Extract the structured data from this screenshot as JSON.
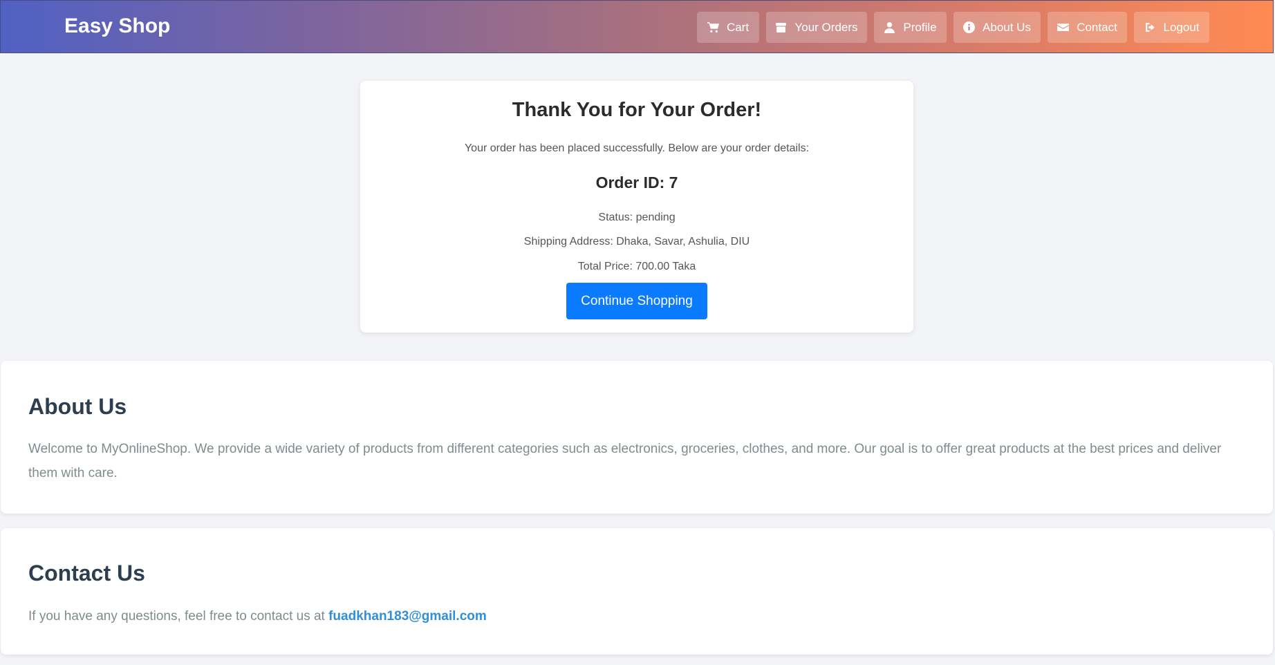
{
  "navbar": {
    "brand": "Easy Shop",
    "items": [
      {
        "label": "Cart",
        "icon": "cart-icon"
      },
      {
        "label": "Your Orders",
        "icon": "box-icon"
      },
      {
        "label": "Profile",
        "icon": "user-icon"
      },
      {
        "label": "About Us",
        "icon": "info-icon"
      },
      {
        "label": "Contact",
        "icon": "envelope-icon"
      },
      {
        "label": "Logout",
        "icon": "logout-icon"
      }
    ]
  },
  "order": {
    "title": "Thank You for Your Order!",
    "message": "Your order has been placed successfully. Below are your order details:",
    "order_id": "Order ID: 7",
    "status": "Status: pending",
    "shipping": "Shipping Address: Dhaka, Savar, Ashulia, DIU",
    "total": "Total Price: 700.00 Taka",
    "button": "Continue Shopping"
  },
  "about": {
    "title": "About Us",
    "text": "Welcome to MyOnlineShop. We provide a wide variety of products from different categories such as electronics, groceries, clothes, and more. Our goal is to offer great products at the best prices and deliver them with care."
  },
  "contact": {
    "title": "Contact Us",
    "text": "If you have any questions, feel free to contact us at",
    "email": "fuadkhan183@gmail.com"
  },
  "colors": {
    "gradient_start": "#5061c4",
    "gradient_end": "#ff8a52",
    "primary_button": "#0a7bff",
    "link": "#2f8fd8",
    "heading": "#2c3e50"
  }
}
